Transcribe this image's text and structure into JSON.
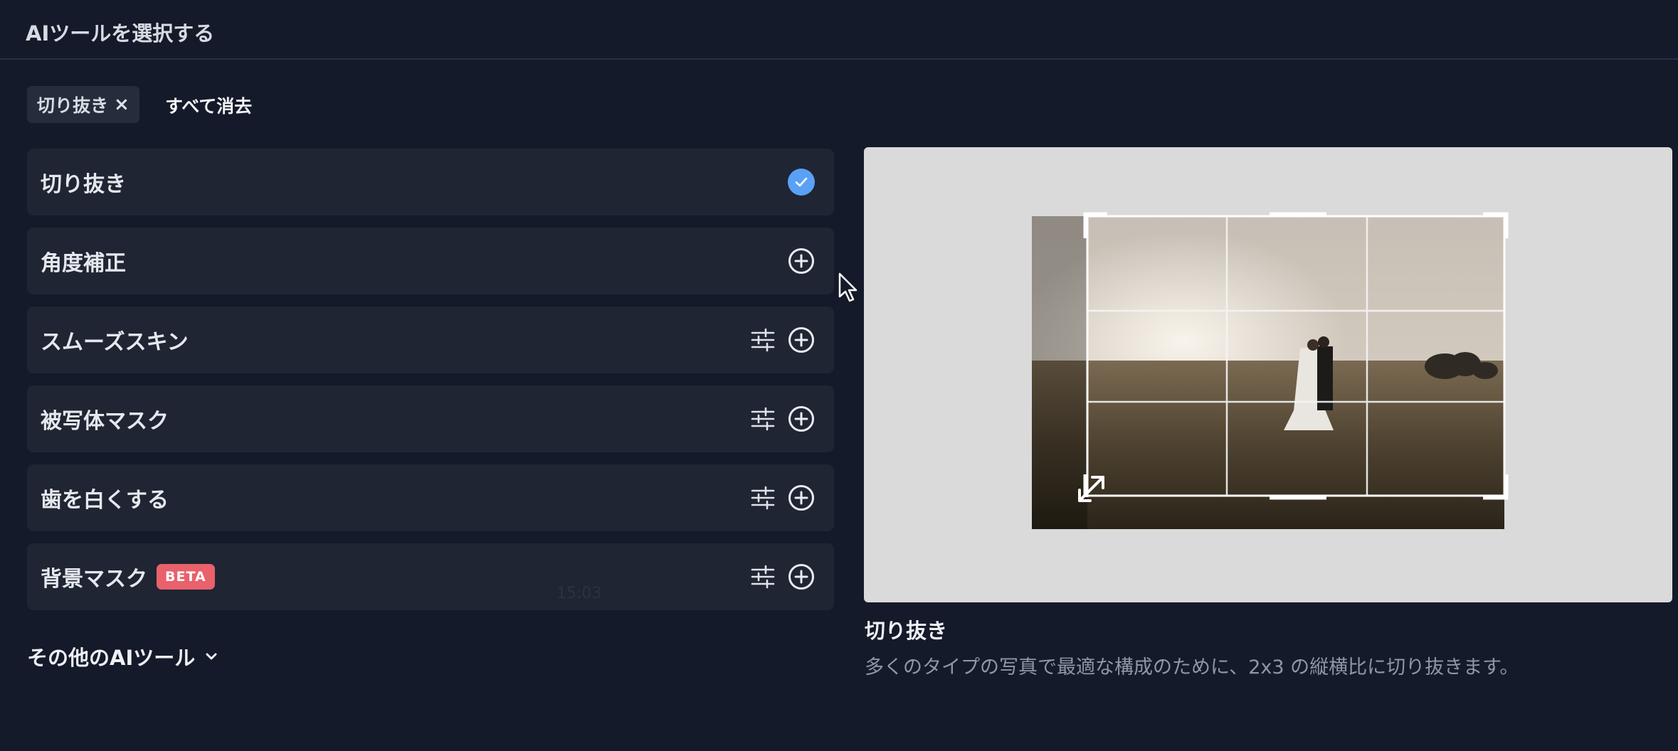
{
  "header": {
    "title": "AIツールを選択する"
  },
  "filters": {
    "chip_label": "切り抜き",
    "chip_remove": "×",
    "clear_all": "すべて消去"
  },
  "tools": [
    {
      "label": "切り抜き",
      "state": "selected",
      "settings": false,
      "beta": ""
    },
    {
      "label": "角度補正",
      "state": "add",
      "settings": false,
      "beta": ""
    },
    {
      "label": "スムーズスキン",
      "state": "add",
      "settings": true,
      "beta": ""
    },
    {
      "label": "被写体マスク",
      "state": "add",
      "settings": true,
      "beta": ""
    },
    {
      "label": "歯を白くする",
      "state": "add",
      "settings": true,
      "beta": ""
    },
    {
      "label": "背景マスク",
      "state": "add",
      "settings": true,
      "beta": "BETA"
    }
  ],
  "more_tools": {
    "label": "その他のAIツール",
    "icon": "chevron-down-icon"
  },
  "preview": {
    "title": "切り抜き",
    "description": "多くのタイプの写真で最適な構成のために、2x3 の縦横比に切り抜きます。"
  },
  "colors": {
    "background": "#141a29",
    "row": "#1f2533",
    "check": "#5aa1f5",
    "beta": "#e8616b",
    "preview_bg": "#dadada"
  }
}
